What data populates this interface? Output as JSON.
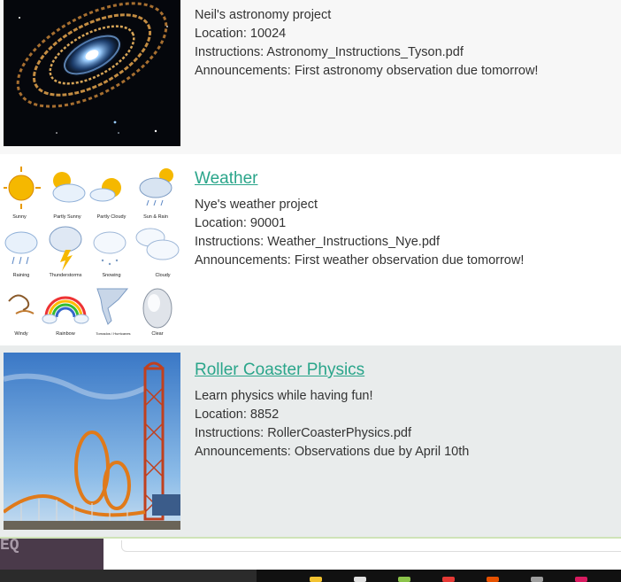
{
  "projects": [
    {
      "title": "",
      "description": "Neil's astronomy project",
      "location": "Location: 10024",
      "instructions": "Instructions: Astronomy_Instructions_Tyson.pdf",
      "announcements": "Announcements: First astronomy observation due tomorrow!",
      "image": "galaxy-image"
    },
    {
      "title": "Weather",
      "description": "Nye's weather project",
      "location": "Location: 90001",
      "instructions": "Instructions: Weather_Instructions_Nye.pdf",
      "announcements": "Announcements: First weather observation due tomorrow!",
      "image": "weather-icons-image",
      "weather_labels": [
        "Sunny",
        "Partly Sunny",
        "Partly Cloudy",
        "Sun & Rain",
        "Raining",
        "Thunderstorms",
        "Snowing",
        "Cloudy",
        "Windy",
        "Rainbow",
        "Tornados / Hurricanes",
        "Clear"
      ]
    },
    {
      "title": "Roller Coaster Physics",
      "description": "Learn physics while having fun!",
      "location": "Location: 8852",
      "instructions": "Instructions: RollerCoasterPhysics.pdf",
      "announcements": "Announcements: Observations due by April 10th",
      "image": "roller-coaster-image"
    }
  ],
  "footer": {
    "left_text": "EQ"
  },
  "colors": {
    "link": "#2aa58a",
    "row_alt": "#e9ecec",
    "footer_dark": "#4a3a4a"
  }
}
